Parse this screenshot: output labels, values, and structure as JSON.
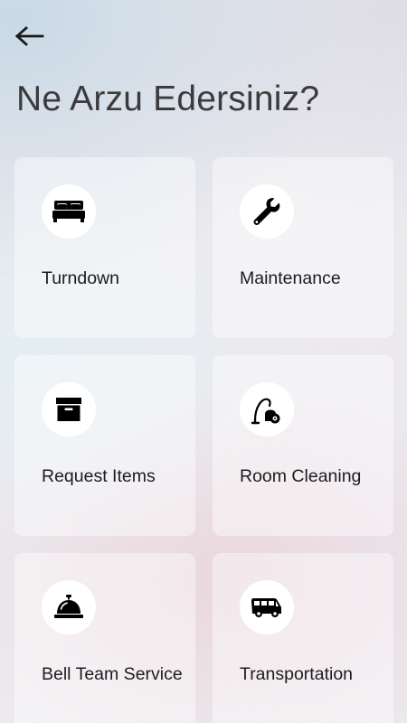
{
  "header": {
    "back_icon": "arrow-left-icon",
    "title": "Ne Arzu Edersiniz?"
  },
  "services": [
    {
      "label": "Turndown",
      "icon": "bed-icon"
    },
    {
      "label": "Maintenance",
      "icon": "wrench-icon"
    },
    {
      "label": "Request Items",
      "icon": "box-icon"
    },
    {
      "label": "Room Cleaning",
      "icon": "vacuum-cleaner-icon"
    },
    {
      "label": "Bell Team Service",
      "icon": "service-bell-icon"
    },
    {
      "label": "Transportation",
      "icon": "van-icon"
    }
  ],
  "colors": {
    "card_background": "#ffffff",
    "icon": "#000000",
    "title_text": "#3b3b3d"
  }
}
